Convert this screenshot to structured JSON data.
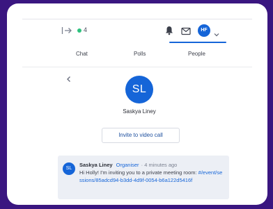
{
  "toolbar": {
    "online_count": "4",
    "avatar_initials": "HF"
  },
  "tabs": [
    {
      "label": "Chat"
    },
    {
      "label": "Polls"
    },
    {
      "label": "People"
    }
  ],
  "active_tab": "People",
  "profile": {
    "initials": "SL",
    "name": "Saskya Liney",
    "invite_label": "Invite to video call"
  },
  "message": {
    "avatar_initials": "SL",
    "sender": "Saskya Liney",
    "role": "Organiser",
    "time": "· 4 minutes ago",
    "text": "Hi Holly! I'm inviting you to a private meeting room: ",
    "link": "#/event/sessions/85adcd94-b3dd-4d9f-0054-b6a122d5416f"
  },
  "colors": {
    "accent": "#1565d8",
    "frame_background": "#3a1680",
    "online": "#2ec27e"
  },
  "icons": [
    "exit-icon",
    "bell-icon",
    "mail-icon",
    "chevron-down-icon",
    "back-arrow-icon"
  ]
}
